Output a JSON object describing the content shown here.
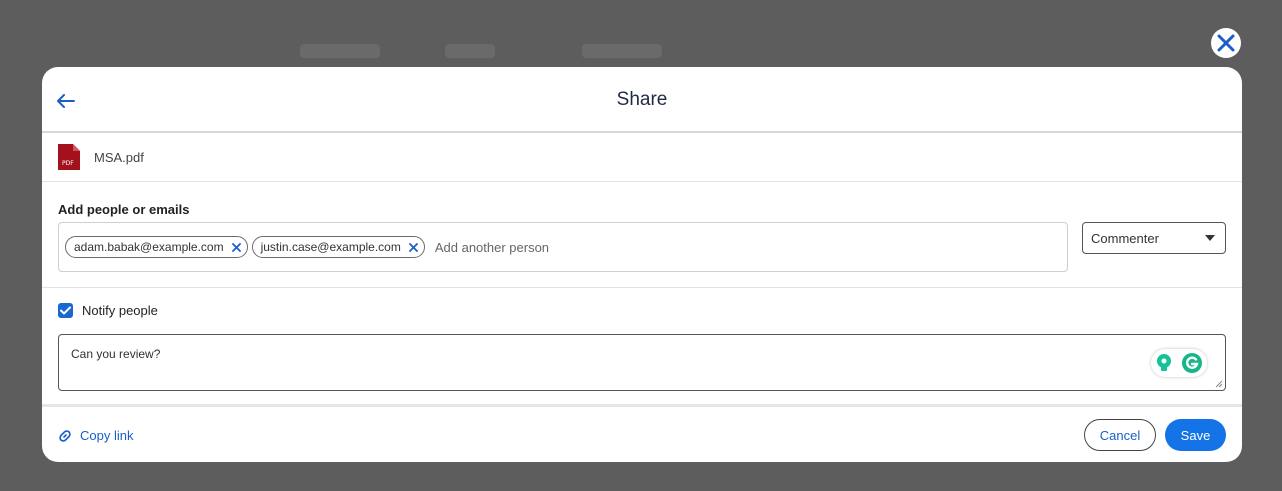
{
  "dialog": {
    "title": "Share",
    "back_icon": "arrow-left-icon",
    "close_icon": "close-icon"
  },
  "file": {
    "icon": "pdf-file-icon",
    "icon_label": "PDF",
    "name": "MSA.pdf"
  },
  "people": {
    "label": "Add people or emails",
    "chips": [
      {
        "email": "adam.babak@example.com"
      },
      {
        "email": "justin.case@example.com"
      }
    ],
    "placeholder": "Add another person",
    "role": "Commenter"
  },
  "notify": {
    "checked": true,
    "label": "Notify people"
  },
  "message": {
    "value": "Can you review?"
  },
  "footer": {
    "copy_link_label": "Copy link",
    "cancel_label": "Cancel",
    "save_label": "Save"
  },
  "colors": {
    "accent": "#1473e6",
    "link": "#1a5fc9",
    "pdf_red": "#a3121c",
    "grammarly": "#15c39a"
  }
}
